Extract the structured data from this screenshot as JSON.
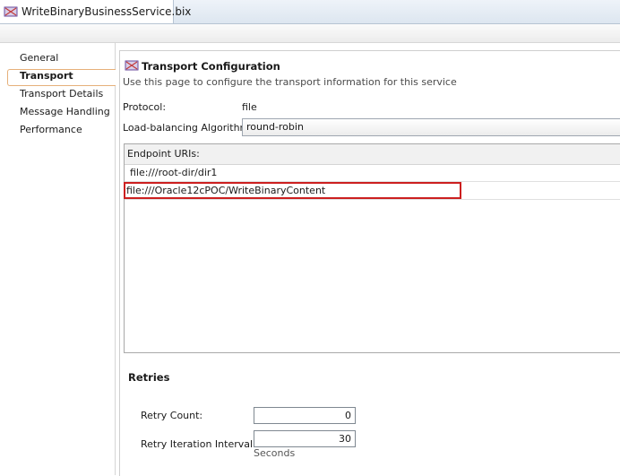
{
  "tab": {
    "title": "WriteBinaryBusinessService.bix"
  },
  "nav": {
    "items": [
      {
        "label": "General"
      },
      {
        "label": "Transport"
      },
      {
        "label": "Transport Details"
      },
      {
        "label": "Message Handling"
      },
      {
        "label": "Performance"
      }
    ],
    "selected": "Transport"
  },
  "transport": {
    "title": "Transport Configuration",
    "description": "Use this page to configure the transport information for this service",
    "protocol_label": "Protocol:",
    "protocol_value": "file",
    "lb_label": "Load-balancing Algorithm:",
    "lb_value": "round-robin",
    "endpoint_label": "Endpoint URIs:",
    "uris": [
      "file:///root-dir/dir1",
      "file:///Oracle12cPOC/WriteBinaryContent"
    ]
  },
  "retries": {
    "title": "Retries",
    "count_label": "Retry Count:",
    "count_value": "0",
    "interval_label": "Retry Iteration Interval:",
    "interval_value": "30",
    "interval_unit": "Seconds"
  },
  "colors": {
    "highlight": "#cc1f1f",
    "selection_border": "#e6b07a"
  },
  "icons": {
    "tab": "business-service-icon",
    "section": "transport-config-icon"
  }
}
